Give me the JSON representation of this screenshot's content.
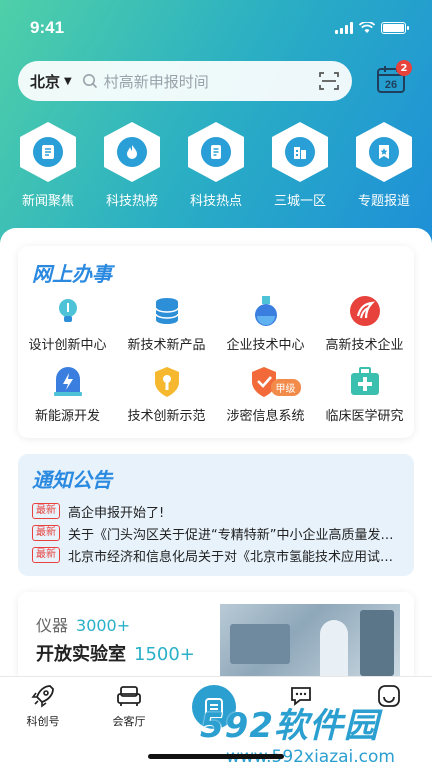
{
  "status": {
    "time": "9:41"
  },
  "search": {
    "city": "北京",
    "placeholder": "村高新申报时间",
    "calendar_day": "26",
    "calendar_badge": "2"
  },
  "categories": [
    {
      "label": "新闻聚焦",
      "icon": "news-icon"
    },
    {
      "label": "科技热榜",
      "icon": "flame-icon"
    },
    {
      "label": "科技热点",
      "icon": "document-icon"
    },
    {
      "label": "三城一区",
      "icon": "buildings-icon"
    },
    {
      "label": "专题报道",
      "icon": "star-bookmark-icon"
    }
  ],
  "online_service": {
    "title": "网上办事",
    "items": [
      {
        "label": "设计创新中心",
        "icon": "lightbulb-icon"
      },
      {
        "label": "新技术新产品",
        "icon": "database-icon"
      },
      {
        "label": "企业技术中心",
        "icon": "flask-icon"
      },
      {
        "label": "高新技术企业",
        "icon": "emblem-icon"
      },
      {
        "label": "新能源开发",
        "icon": "lightning-icon"
      },
      {
        "label": "技术创新示范",
        "icon": "shield-key-icon"
      },
      {
        "label": "涉密信息系统",
        "icon": "shield-check-icon",
        "tag": "甲级"
      },
      {
        "label": "临床医学研究",
        "icon": "medical-kit-icon"
      }
    ]
  },
  "notices": {
    "title": "通知公告",
    "new_tag": "最新",
    "items": [
      "高企申报开始了!",
      "关于《门头沟区关于促进“专精特新”中小企业高质量发展的若干措施》",
      "北京市经济和信息化局关于对《北京市氢能技术应用试点工作方案》"
    ]
  },
  "promo": {
    "line1_label": "仪器",
    "line1_value": "3000+",
    "line2_label": "开放实验室",
    "line2_value": "1500+"
  },
  "tabbar": {
    "items": [
      {
        "label": "科创号",
        "icon": "rocket-icon"
      },
      {
        "label": "会客厅",
        "icon": "sofa-icon"
      },
      {
        "label": "",
        "icon": "center-fab-icon"
      },
      {
        "label": "",
        "icon": "chat-icon"
      },
      {
        "label": "",
        "icon": "smile-icon"
      }
    ]
  },
  "watermark": {
    "line1": "592软件园",
    "line2": "www.592xiazai.com"
  },
  "colors": {
    "accent": "#2b8ae0",
    "teal": "#2ab0c8",
    "red": "#e8423c"
  }
}
